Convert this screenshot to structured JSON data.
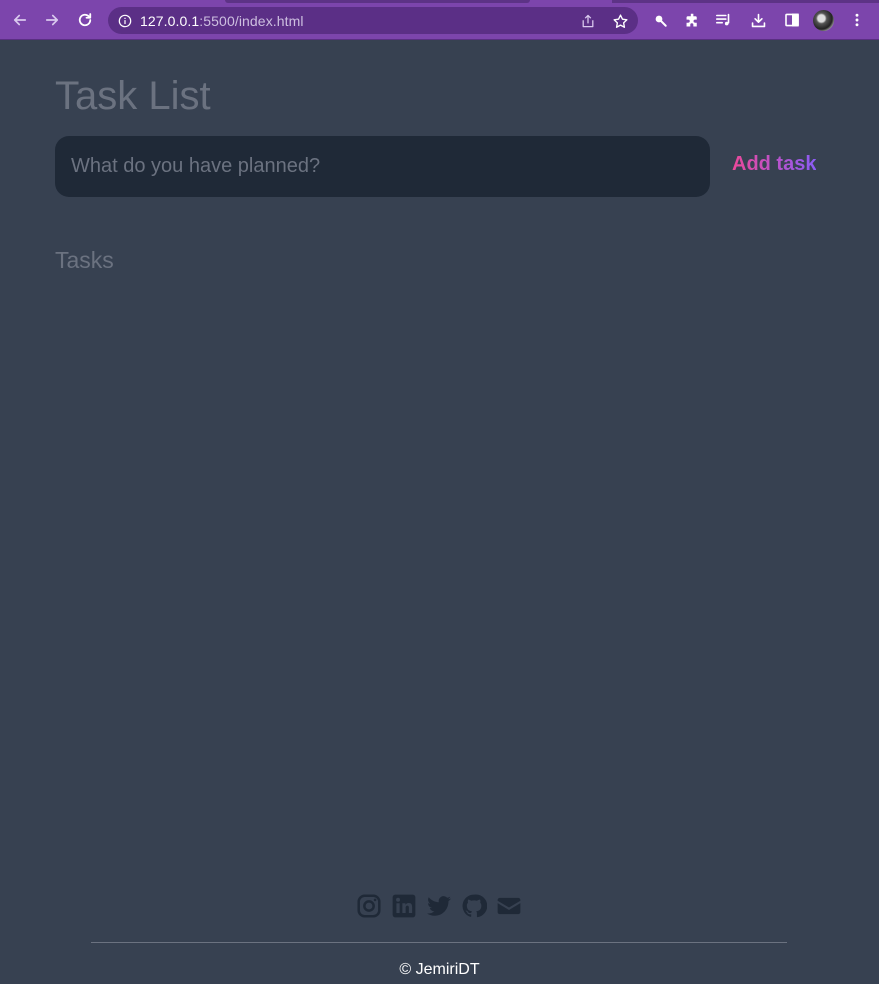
{
  "browser": {
    "url_host": "127.0.0.1",
    "url_path": ":5500/index.html",
    "accent_color": "#7c45ac"
  },
  "page": {
    "title": "Task List",
    "input_placeholder": "What do you have planned?",
    "input_value": "",
    "add_button_label": "Add task",
    "tasks_heading": "Tasks",
    "tasks": []
  },
  "footer": {
    "social_icons": [
      "instagram-icon",
      "linkedin-icon",
      "twitter-icon",
      "github-icon",
      "email-icon"
    ],
    "copyright": "© JemiriDT"
  },
  "colors": {
    "background": "#374151",
    "input_bg": "#1f2937",
    "muted_text": "#6b7280",
    "button_gradient_start": "#ec4899",
    "button_gradient_end": "#8b5cf6"
  }
}
